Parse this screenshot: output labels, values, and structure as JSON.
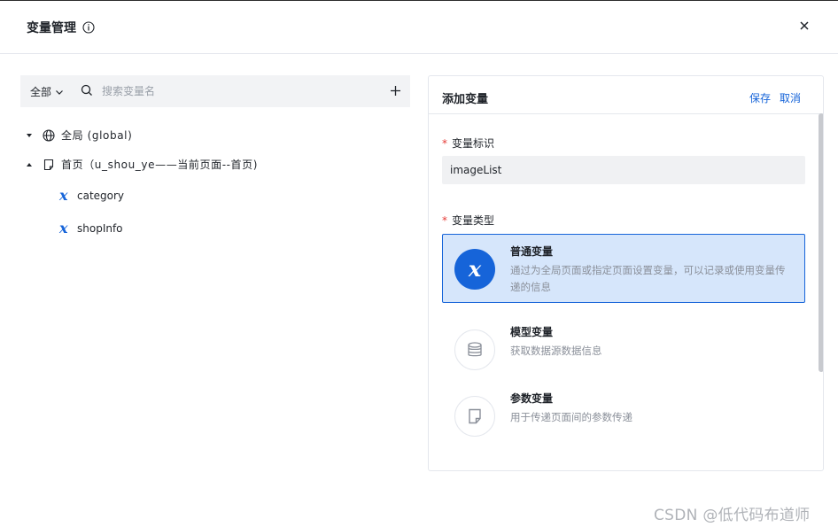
{
  "dialog": {
    "title": "变量管理",
    "close_icon": "close-icon",
    "info_icon": "info-icon"
  },
  "filter": {
    "scope_label": "全部",
    "search_placeholder": "搜索变量名"
  },
  "tree": {
    "global_label": "全局 (global)",
    "page_label": "首页（u_shou_ye——当前页面--首页)",
    "variables": [
      "category",
      "shopInfo"
    ]
  },
  "panel": {
    "title": "添加变量",
    "save_label": "保存",
    "cancel_label": "取消",
    "id_label": "变量标识",
    "id_value": "imageList",
    "type_label": "变量类型",
    "required_mark": "*",
    "types": [
      {
        "name": "普通变量",
        "desc": "通过为全局页面或指定页面设置变量，可以记录或使用变量传递的信息",
        "icon": "variable-x-icon",
        "selected": true
      },
      {
        "name": "模型变量",
        "desc": "获取数据源数据信息",
        "icon": "database-icon",
        "selected": false
      },
      {
        "name": "参数变量",
        "desc": "用于传递页面间的参数传递",
        "icon": "document-icon",
        "selected": false
      }
    ]
  },
  "watermark": "CSDN @低代码布道师",
  "colors": {
    "accent": "#1664d9",
    "selected_bg": "#d6e6fb",
    "required": "#e53935"
  }
}
